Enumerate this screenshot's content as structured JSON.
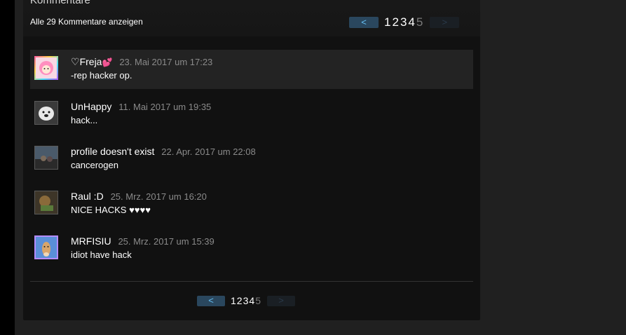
{
  "section": {
    "title": "Kommentare",
    "view_all": "Alle 29 Kommentare anzeigen"
  },
  "pagination": {
    "prev": "<",
    "next": ">",
    "pages": [
      "1",
      "2",
      "3",
      "4",
      "5"
    ]
  },
  "comments": [
    {
      "author_prefix": "♡",
      "author": "Freja",
      "author_suffix": "💕",
      "time": "23. Mai 2017 um 17:23",
      "text": "-rep hacker op."
    },
    {
      "author": "UnHappy",
      "time": "11. Mai 2017 um 19:35",
      "text": "hack..."
    },
    {
      "author": "profile doesn't exist",
      "time": "22. Apr. 2017 um 22:08",
      "text": "cancerogen"
    },
    {
      "author": "Raul :D",
      "time": "25. Mrz. 2017 um 16:20",
      "text": "NICE HACKS ♥♥♥♥"
    },
    {
      "author": "MRFISIU",
      "time": "25. Mrz. 2017 um 15:39",
      "text": "idiot have hack"
    }
  ],
  "colors": {
    "accent": "#66c0f4",
    "button_bg": "#2a475e",
    "panel_bg": "#111111"
  },
  "icons": {
    "prev": "chevron-left-icon",
    "next": "chevron-right-icon"
  }
}
